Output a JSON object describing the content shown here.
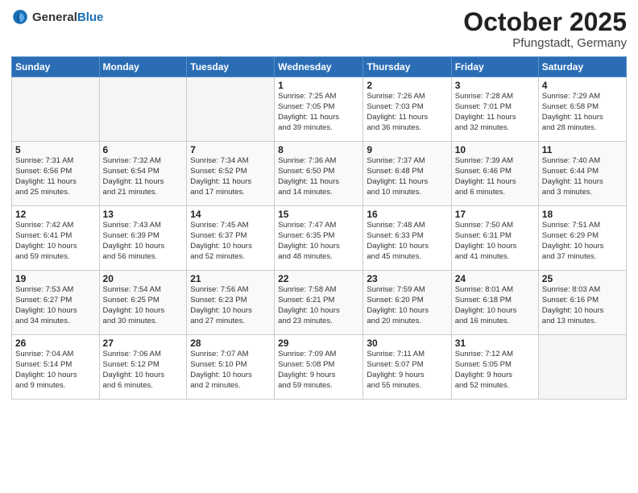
{
  "header": {
    "logo_general": "General",
    "logo_blue": "Blue",
    "month": "October 2025",
    "location": "Pfungstadt, Germany"
  },
  "days_of_week": [
    "Sunday",
    "Monday",
    "Tuesday",
    "Wednesday",
    "Thursday",
    "Friday",
    "Saturday"
  ],
  "weeks": [
    [
      {
        "day": "",
        "info": ""
      },
      {
        "day": "",
        "info": ""
      },
      {
        "day": "",
        "info": ""
      },
      {
        "day": "1",
        "info": "Sunrise: 7:25 AM\nSunset: 7:05 PM\nDaylight: 11 hours\nand 39 minutes."
      },
      {
        "day": "2",
        "info": "Sunrise: 7:26 AM\nSunset: 7:03 PM\nDaylight: 11 hours\nand 36 minutes."
      },
      {
        "day": "3",
        "info": "Sunrise: 7:28 AM\nSunset: 7:01 PM\nDaylight: 11 hours\nand 32 minutes."
      },
      {
        "day": "4",
        "info": "Sunrise: 7:29 AM\nSunset: 6:58 PM\nDaylight: 11 hours\nand 28 minutes."
      }
    ],
    [
      {
        "day": "5",
        "info": "Sunrise: 7:31 AM\nSunset: 6:56 PM\nDaylight: 11 hours\nand 25 minutes."
      },
      {
        "day": "6",
        "info": "Sunrise: 7:32 AM\nSunset: 6:54 PM\nDaylight: 11 hours\nand 21 minutes."
      },
      {
        "day": "7",
        "info": "Sunrise: 7:34 AM\nSunset: 6:52 PM\nDaylight: 11 hours\nand 17 minutes."
      },
      {
        "day": "8",
        "info": "Sunrise: 7:36 AM\nSunset: 6:50 PM\nDaylight: 11 hours\nand 14 minutes."
      },
      {
        "day": "9",
        "info": "Sunrise: 7:37 AM\nSunset: 6:48 PM\nDaylight: 11 hours\nand 10 minutes."
      },
      {
        "day": "10",
        "info": "Sunrise: 7:39 AM\nSunset: 6:46 PM\nDaylight: 11 hours\nand 6 minutes."
      },
      {
        "day": "11",
        "info": "Sunrise: 7:40 AM\nSunset: 6:44 PM\nDaylight: 11 hours\nand 3 minutes."
      }
    ],
    [
      {
        "day": "12",
        "info": "Sunrise: 7:42 AM\nSunset: 6:41 PM\nDaylight: 10 hours\nand 59 minutes."
      },
      {
        "day": "13",
        "info": "Sunrise: 7:43 AM\nSunset: 6:39 PM\nDaylight: 10 hours\nand 56 minutes."
      },
      {
        "day": "14",
        "info": "Sunrise: 7:45 AM\nSunset: 6:37 PM\nDaylight: 10 hours\nand 52 minutes."
      },
      {
        "day": "15",
        "info": "Sunrise: 7:47 AM\nSunset: 6:35 PM\nDaylight: 10 hours\nand 48 minutes."
      },
      {
        "day": "16",
        "info": "Sunrise: 7:48 AM\nSunset: 6:33 PM\nDaylight: 10 hours\nand 45 minutes."
      },
      {
        "day": "17",
        "info": "Sunrise: 7:50 AM\nSunset: 6:31 PM\nDaylight: 10 hours\nand 41 minutes."
      },
      {
        "day": "18",
        "info": "Sunrise: 7:51 AM\nSunset: 6:29 PM\nDaylight: 10 hours\nand 37 minutes."
      }
    ],
    [
      {
        "day": "19",
        "info": "Sunrise: 7:53 AM\nSunset: 6:27 PM\nDaylight: 10 hours\nand 34 minutes."
      },
      {
        "day": "20",
        "info": "Sunrise: 7:54 AM\nSunset: 6:25 PM\nDaylight: 10 hours\nand 30 minutes."
      },
      {
        "day": "21",
        "info": "Sunrise: 7:56 AM\nSunset: 6:23 PM\nDaylight: 10 hours\nand 27 minutes."
      },
      {
        "day": "22",
        "info": "Sunrise: 7:58 AM\nSunset: 6:21 PM\nDaylight: 10 hours\nand 23 minutes."
      },
      {
        "day": "23",
        "info": "Sunrise: 7:59 AM\nSunset: 6:20 PM\nDaylight: 10 hours\nand 20 minutes."
      },
      {
        "day": "24",
        "info": "Sunrise: 8:01 AM\nSunset: 6:18 PM\nDaylight: 10 hours\nand 16 minutes."
      },
      {
        "day": "25",
        "info": "Sunrise: 8:03 AM\nSunset: 6:16 PM\nDaylight: 10 hours\nand 13 minutes."
      }
    ],
    [
      {
        "day": "26",
        "info": "Sunrise: 7:04 AM\nSunset: 5:14 PM\nDaylight: 10 hours\nand 9 minutes."
      },
      {
        "day": "27",
        "info": "Sunrise: 7:06 AM\nSunset: 5:12 PM\nDaylight: 10 hours\nand 6 minutes."
      },
      {
        "day": "28",
        "info": "Sunrise: 7:07 AM\nSunset: 5:10 PM\nDaylight: 10 hours\nand 2 minutes."
      },
      {
        "day": "29",
        "info": "Sunrise: 7:09 AM\nSunset: 5:08 PM\nDaylight: 9 hours\nand 59 minutes."
      },
      {
        "day": "30",
        "info": "Sunrise: 7:11 AM\nSunset: 5:07 PM\nDaylight: 9 hours\nand 55 minutes."
      },
      {
        "day": "31",
        "info": "Sunrise: 7:12 AM\nSunset: 5:05 PM\nDaylight: 9 hours\nand 52 minutes."
      },
      {
        "day": "",
        "info": ""
      }
    ]
  ]
}
